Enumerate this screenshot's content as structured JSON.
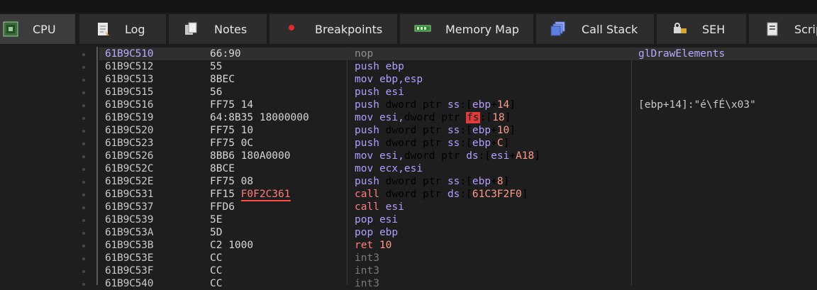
{
  "tabs": [
    {
      "label": "CPU",
      "icon": "cpu-icon",
      "active": true
    },
    {
      "label": "Log",
      "icon": "log-icon"
    },
    {
      "label": "Notes",
      "icon": "notes-icon"
    },
    {
      "label": "Breakpoints",
      "icon": "breakpoint-icon"
    },
    {
      "label": "Memory Map",
      "icon": "memory-map-icon"
    },
    {
      "label": "Call Stack",
      "icon": "call-stack-icon"
    },
    {
      "label": "SEH",
      "icon": "seh-icon"
    },
    {
      "label": "Scrip",
      "icon": "script-icon"
    }
  ],
  "disasm": {
    "rows": [
      {
        "addr": "61B9C510",
        "bytes": "66:90",
        "ins": "nop",
        "comment": "glDrawElements",
        "selected": true
      },
      {
        "addr": "61B9C512",
        "bytes": "55",
        "ins": "push ebp"
      },
      {
        "addr": "61B9C513",
        "bytes": "8BEC",
        "ins": "mov ebp,esp"
      },
      {
        "addr": "61B9C515",
        "bytes": "56",
        "ins": "push esi"
      },
      {
        "addr": "61B9C516",
        "bytes": "FF75 14",
        "ins": "push dword ptr ss:[ebp+14]",
        "comment": "[ebp+14]:\"é\\fÉ\\x03\""
      },
      {
        "addr": "61B9C519",
        "bytes": "64:8B35 18000000",
        "ins": "mov esi,dword ptr fs:[18]"
      },
      {
        "addr": "61B9C520",
        "bytes": "FF75 10",
        "ins": "push dword ptr ss:[ebp+10]"
      },
      {
        "addr": "61B9C523",
        "bytes": "FF75 0C",
        "ins": "push dword ptr ss:[ebp+C]"
      },
      {
        "addr": "61B9C526",
        "bytes": "8BB6 180A0000",
        "ins": "mov esi,dword ptr ds:[esi+A18]"
      },
      {
        "addr": "61B9C52C",
        "bytes": "8BCE",
        "ins": "mov ecx,esi"
      },
      {
        "addr": "61B9C52E",
        "bytes": "FF75 08",
        "ins": "push dword ptr ss:[ebp+8]"
      },
      {
        "addr": "61B9C531",
        "bytes": "FF15 F0F2C361",
        "ins": "call dword ptr ds:[61C3F2F0]"
      },
      {
        "addr": "61B9C537",
        "bytes": "FFD6",
        "ins": "call esi"
      },
      {
        "addr": "61B9C539",
        "bytes": "5E",
        "ins": "pop esi"
      },
      {
        "addr": "61B9C53A",
        "bytes": "5D",
        "ins": "pop ebp"
      },
      {
        "addr": "61B9C53B",
        "bytes": "C2 1000",
        "ins": "ret 10"
      },
      {
        "addr": "61B9C53E",
        "bytes": "CC",
        "ins": "int3"
      },
      {
        "addr": "61B9C53F",
        "bytes": "CC",
        "ins": "int3"
      },
      {
        "addr": "61B9C540",
        "bytes": "CC",
        "ins": "int3"
      }
    ]
  },
  "colors": {
    "accent": "#6a6fd4",
    "mnemonic": "#b39cff",
    "call": "#ff7e7e",
    "selected_addr": "#b9a9ff"
  }
}
